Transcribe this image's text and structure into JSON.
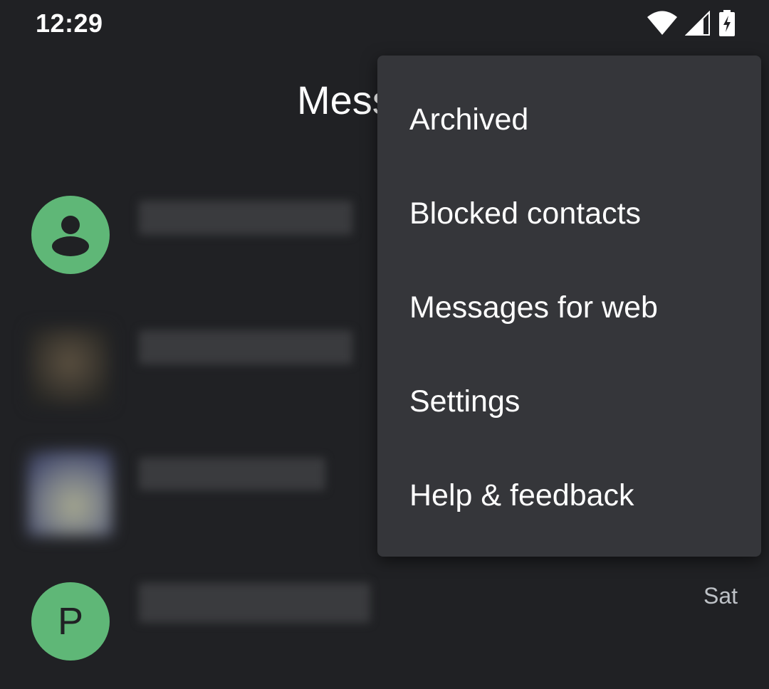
{
  "status_bar": {
    "time": "12:29",
    "icons": [
      "wifi-icon",
      "cell-signal-icon",
      "battery-charging-icon"
    ]
  },
  "app_bar": {
    "title": "Mess"
  },
  "conversations": [
    {
      "avatar": "person-icon",
      "avatar_color": "#5fb777",
      "time": ""
    },
    {
      "avatar": "blurred-photo",
      "time": ""
    },
    {
      "avatar": "blurred-photo",
      "time": ""
    },
    {
      "avatar_letter": "P",
      "avatar_color": "#5fb777",
      "time": "Sat"
    }
  ],
  "overflow_menu": {
    "items": [
      {
        "label": "Archived"
      },
      {
        "label": "Blocked contacts"
      },
      {
        "label": "Messages for web"
      },
      {
        "label": "Settings"
      },
      {
        "label": "Help & feedback"
      }
    ]
  },
  "colors": {
    "background": "#202124",
    "menu_background": "#35363a",
    "avatar_green": "#5fb777",
    "text_primary": "#ffffff",
    "text_secondary": "#bdc1c6"
  }
}
